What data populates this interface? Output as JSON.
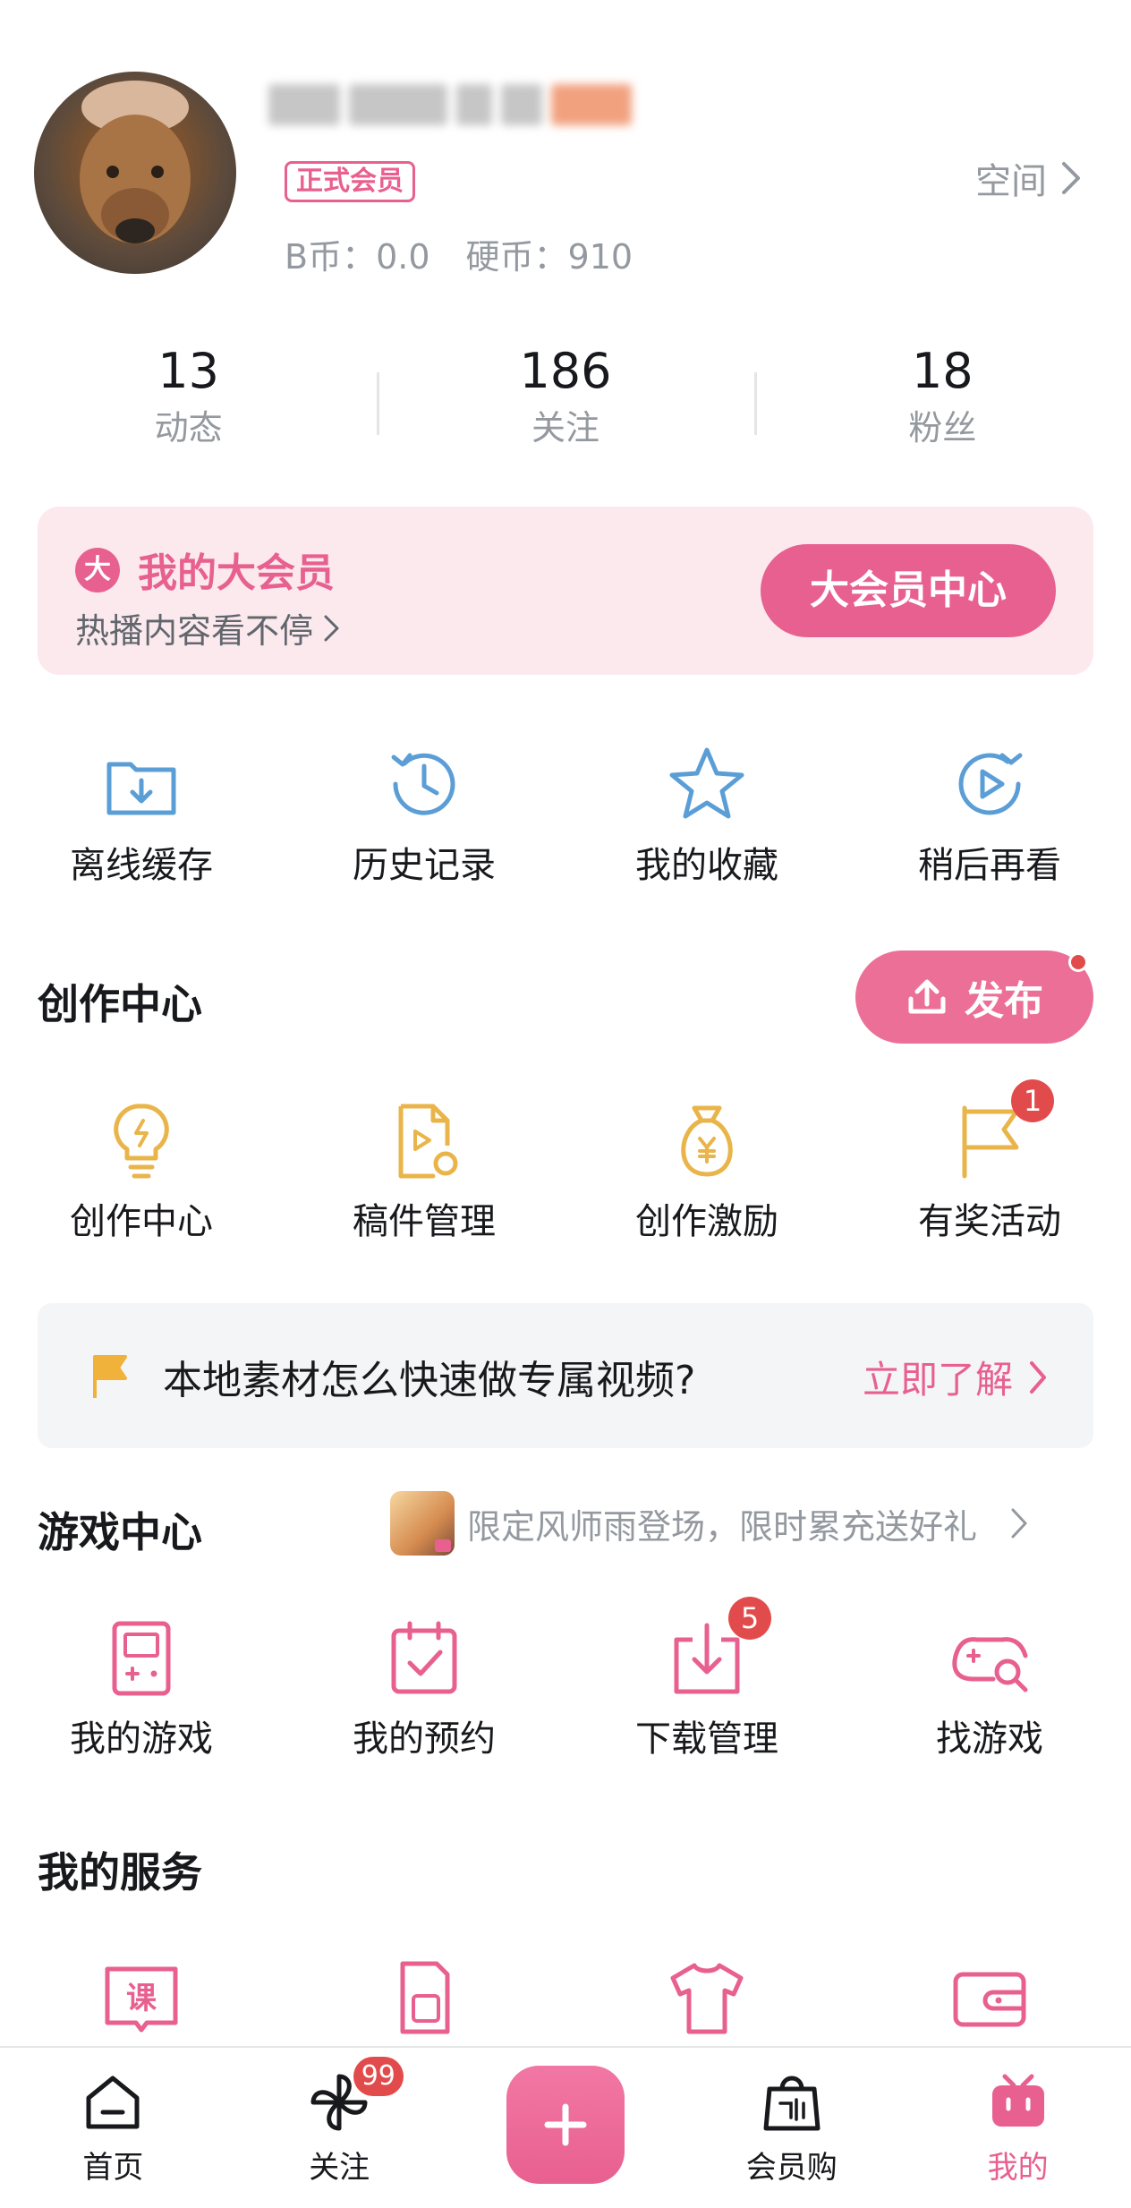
{
  "profile": {
    "vip_tag": "正式会员",
    "b_coin": "B币：0.0",
    "hard_coin": "硬币：910",
    "space_label": "空间"
  },
  "stats": [
    {
      "value": "13",
      "label": "动态"
    },
    {
      "value": "186",
      "label": "关注"
    },
    {
      "value": "18",
      "label": "粉丝"
    }
  ],
  "vip_banner": {
    "badge": "大",
    "title": "我的大会员",
    "subtitle": "热播内容看不停",
    "button": "大会员中心"
  },
  "quick_actions": [
    {
      "label": "离线缓存",
      "icon": "offline-cache-icon"
    },
    {
      "label": "历史记录",
      "icon": "history-icon"
    },
    {
      "label": "我的收藏",
      "icon": "favorites-star-icon"
    },
    {
      "label": "稍后再看",
      "icon": "watch-later-icon"
    }
  ],
  "creation": {
    "title": "创作中心",
    "publish_button": "发布",
    "items": [
      {
        "label": "创作中心",
        "icon": "lightbulb-icon",
        "badge": ""
      },
      {
        "label": "稿件管理",
        "icon": "manuscript-icon",
        "badge": ""
      },
      {
        "label": "创作激励",
        "icon": "money-bag-icon",
        "badge": ""
      },
      {
        "label": "有奖活动",
        "icon": "flag-icon",
        "badge": "1"
      }
    ]
  },
  "tip": {
    "text": "本地素材怎么快速做专属视频?",
    "link": "立即了解"
  },
  "game": {
    "title": "游戏中心",
    "promo": "限定风师雨登场，限时累充送好礼",
    "items": [
      {
        "label": "我的游戏",
        "icon": "gameboy-icon",
        "badge": ""
      },
      {
        "label": "我的预约",
        "icon": "calendar-check-icon",
        "badge": ""
      },
      {
        "label": "下载管理",
        "icon": "download-icon",
        "badge": "5"
      },
      {
        "label": "找游戏",
        "icon": "gamepad-search-icon",
        "badge": ""
      }
    ]
  },
  "services": {
    "title": "我的服务",
    "items": [
      {
        "label": "课",
        "icon": "course-book-icon"
      },
      {
        "label": "",
        "icon": "sim-card-icon"
      },
      {
        "label": "",
        "icon": "tshirt-icon"
      },
      {
        "label": "",
        "icon": "wallet-icon"
      }
    ]
  },
  "bottom_nav": [
    {
      "label": "首页",
      "icon": "home-icon"
    },
    {
      "label": "关注",
      "icon": "pinwheel-icon",
      "badge": "99"
    },
    {
      "label": "",
      "icon": "plus-icon"
    },
    {
      "label": "会员购",
      "icon": "shopping-bag-icon"
    },
    {
      "label": "我的",
      "icon": "tv-mine-icon"
    }
  ],
  "colors": {
    "pink": "#e8608f",
    "blue_icon": "#5b9ed6",
    "yellow_icon": "#e9b54a",
    "gray_text": "#9499a0",
    "badge_red": "#e24b4b"
  }
}
